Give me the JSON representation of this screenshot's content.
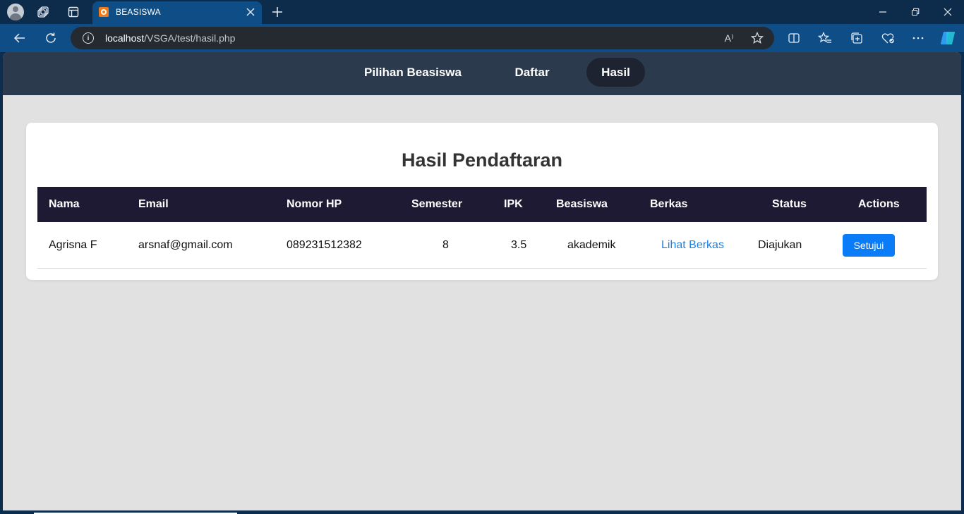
{
  "browser": {
    "tab_title": "BEASISWA",
    "url_host": "localhost",
    "url_path": "/VSGA/test/hasil.php",
    "info_glyph": "i",
    "icons": [
      "profile-avatar",
      "workspaces-icon",
      "tab-actions-icon",
      "close-tab-icon",
      "new-tab-icon",
      "minimize-icon",
      "restore-icon",
      "close-window-icon",
      "back-icon",
      "refresh-icon",
      "site-info-icon",
      "read-aloud-icon",
      "favorite-star-icon",
      "split-screen-icon",
      "favorites-icon",
      "collections-icon",
      "browser-essentials-icon",
      "more-icon",
      "copilot-icon"
    ],
    "read_aloud_glyph": "A⁾"
  },
  "site_nav": {
    "items": [
      {
        "label": "Pilihan Beasiswa"
      },
      {
        "label": "Daftar"
      },
      {
        "label": "Hasil"
      }
    ],
    "active_index": 2
  },
  "page": {
    "title": "Hasil Pendaftaran"
  },
  "table": {
    "headers": [
      "Nama",
      "Email",
      "Nomor HP",
      "Semester",
      "IPK",
      "Beasiswa",
      "Berkas",
      "Status",
      "Actions"
    ],
    "rows": [
      {
        "nama": "Agrisna F",
        "email": "arsnaf@gmail.com",
        "nomor_hp": "089231512382",
        "semester": "8",
        "ipk": "3.5",
        "beasiswa": "akademik",
        "berkas": "Lihat Berkas",
        "status": "Diajukan",
        "action": "Setujui"
      }
    ]
  },
  "colors": {
    "page_bg": "#e1e1e1",
    "site_nav_bg": "#2b3a4c",
    "table_header_bg": "#1e1a34",
    "link": "#1e7fe6",
    "button": "#0a7cf8"
  }
}
